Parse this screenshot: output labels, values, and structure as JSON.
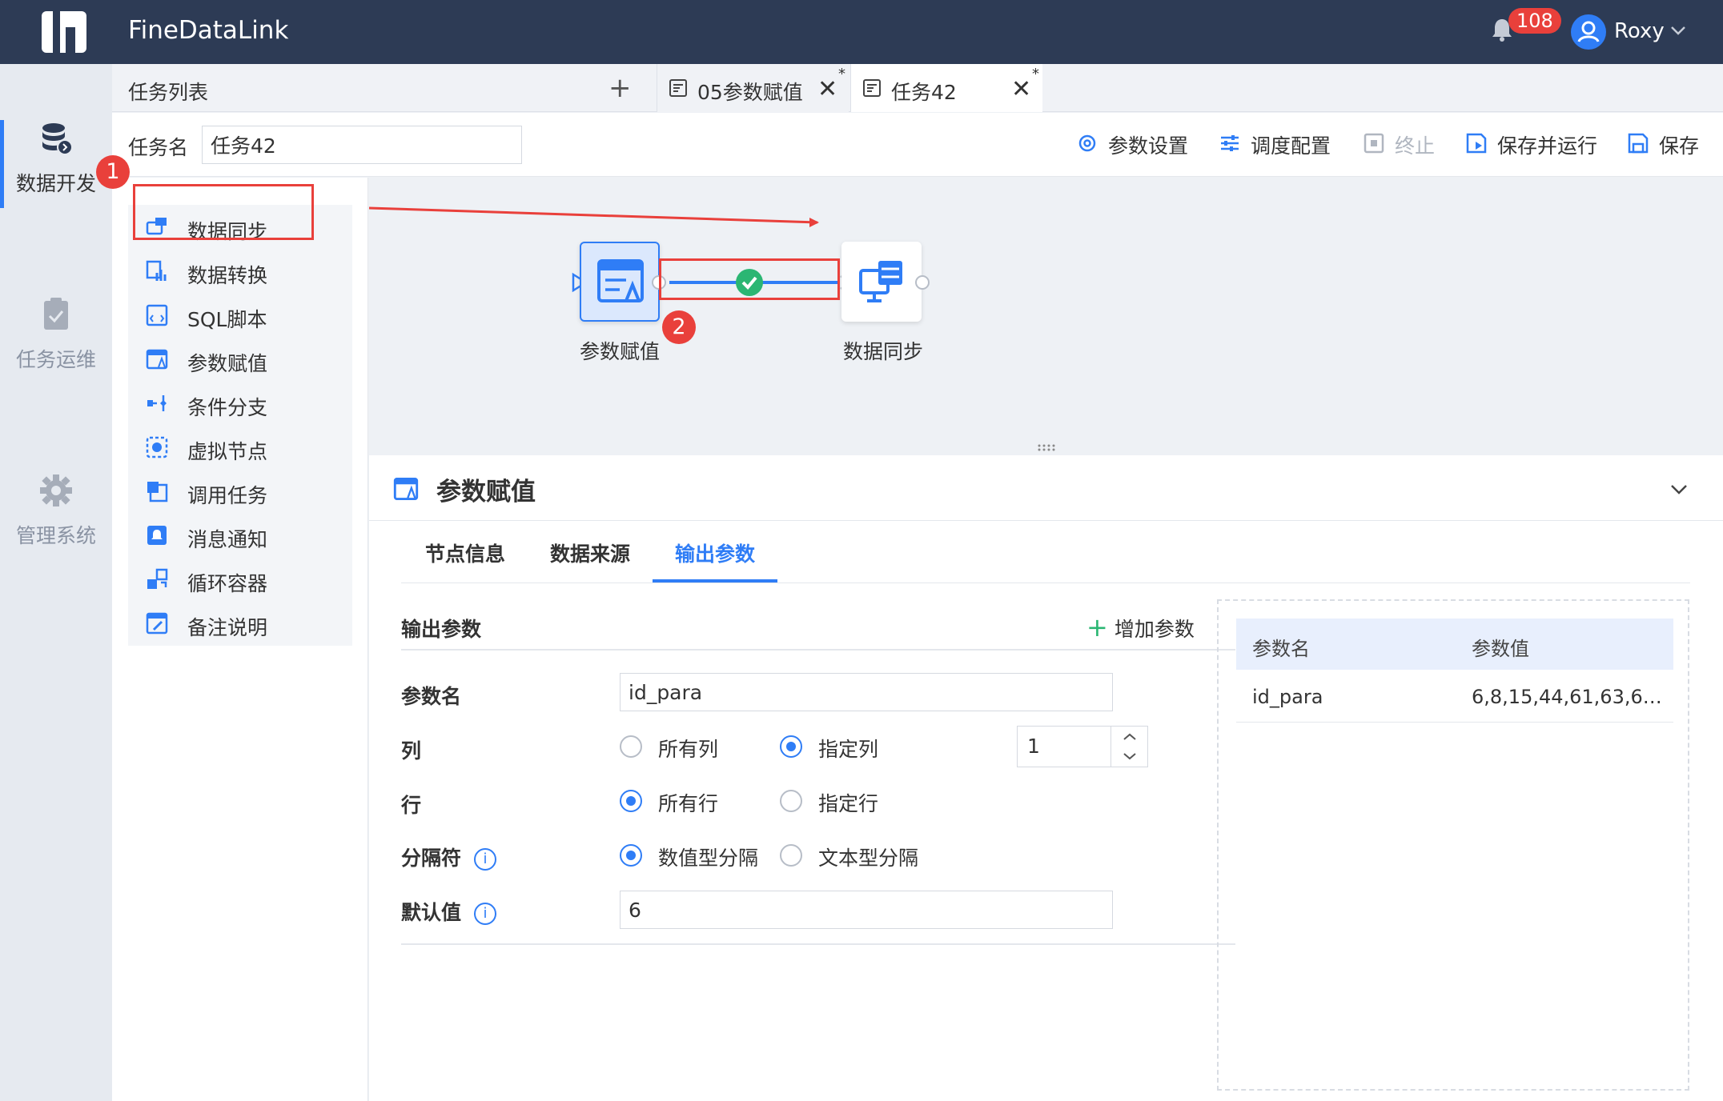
{
  "app": {
    "title": "FineDataLink",
    "notification_count": "108",
    "user_name": "Roxy"
  },
  "leftnav": [
    {
      "label": "数据开发",
      "icon": "database-icon",
      "active": true
    },
    {
      "label": "任务运维",
      "icon": "clipboard-check-icon",
      "active": false
    },
    {
      "label": "管理系统",
      "icon": "gear-icon",
      "active": false
    }
  ],
  "tabstrip": {
    "list_label": "任务列表",
    "add_symbol": "+",
    "tabs": [
      {
        "label": "05参数赋值",
        "modified": "*"
      },
      {
        "label": "任务42",
        "modified": "*"
      }
    ]
  },
  "toolbar": {
    "task_name_label": "任务名",
    "task_name_value": "任务42",
    "buttons": [
      "参数设置",
      "调度配置",
      "终止",
      "保存并运行",
      "保存"
    ]
  },
  "nodelist": [
    "数据同步",
    "数据转换",
    "SQL脚本",
    "参数赋值",
    "条件分支",
    "虚拟节点",
    "调用任务",
    "消息通知",
    "循环容器",
    "备注说明"
  ],
  "canvas": {
    "nodes": [
      "参数赋值",
      "数据同步"
    ],
    "markers": [
      "1",
      "2"
    ]
  },
  "detail": {
    "title": "参数赋值",
    "tabs": [
      "节点信息",
      "数据来源",
      "输出参数"
    ],
    "active_tab": "输出参数",
    "section_title": "输出参数",
    "add_param_label": "增加参数",
    "form": {
      "param_name_label": "参数名",
      "param_name_value": "id_para",
      "column_label": "列",
      "column_opt_all": "所有列",
      "column_opt_specified": "指定列",
      "column_selected": "指定列",
      "column_index": "1",
      "row_label": "行",
      "row_opt_all": "所有行",
      "row_opt_specified": "指定行",
      "row_selected": "所有行",
      "separator_label": "分隔符",
      "separator_opt_numeric": "数值型分隔",
      "separator_opt_text": "文本型分隔",
      "separator_selected": "数值型分隔",
      "default_label": "默认值",
      "default_value": "6",
      "info_symbol": "i"
    },
    "preview": {
      "headers": [
        "参数名",
        "参数值"
      ],
      "rows": [
        {
          "name": "id_para",
          "value": "6,8,15,44,61,63,65,6…"
        }
      ]
    }
  },
  "colors": {
    "topbar": "#2d3b55",
    "accent": "#2f7df6",
    "annotation_red": "#e9403b",
    "success_green": "#2bb673"
  }
}
